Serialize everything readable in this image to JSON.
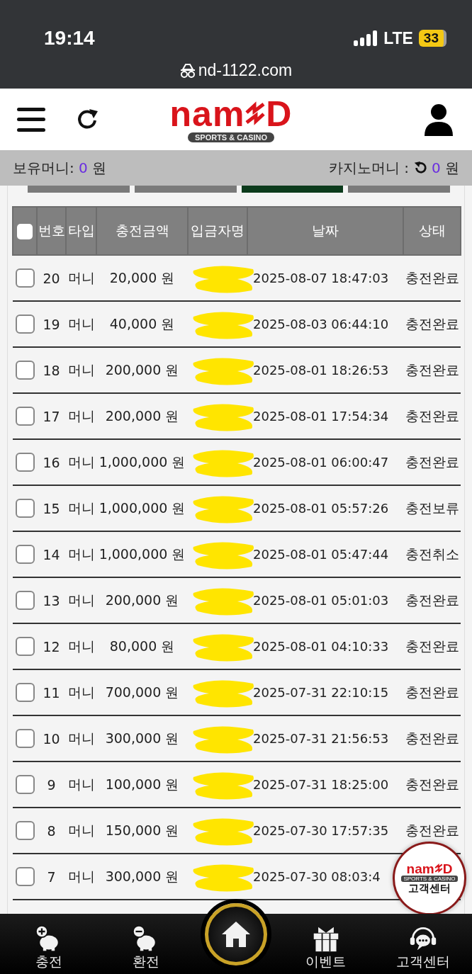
{
  "status_bar": {
    "time": "19:14",
    "network": "LTE",
    "battery": "33"
  },
  "browser": {
    "url": "nd-1122.com"
  },
  "header": {
    "logo_left": "nam",
    "logo_right": "D",
    "logo_tagline": "SPORTS & CASINO"
  },
  "balance": {
    "money_label": "보유머니:",
    "money_value": "0",
    "money_unit": "원",
    "casino_label": "카지노머니 :",
    "casino_value": "0",
    "casino_unit": "원"
  },
  "tabs": [
    {
      "selected": false
    },
    {
      "selected": false
    },
    {
      "selected": true
    },
    {
      "selected": false
    }
  ],
  "table": {
    "select_all_checked": false,
    "columns": [
      "번호",
      "타입",
      "충전금액",
      "입금자명",
      "날짜",
      "상태"
    ],
    "rows": [
      {
        "no": "20",
        "type": "머니",
        "amount": "20,000 원",
        "redacted": true,
        "date": "2025-08-07 18:47:03",
        "status": "충전완료",
        "checked": false
      },
      {
        "no": "19",
        "type": "머니",
        "amount": "40,000 원",
        "redacted": true,
        "date": "2025-08-03 06:44:10",
        "status": "충전완료",
        "checked": false
      },
      {
        "no": "18",
        "type": "머니",
        "amount": "200,000 원",
        "redacted": true,
        "date": "2025-08-01 18:26:53",
        "status": "충전완료",
        "checked": false
      },
      {
        "no": "17",
        "type": "머니",
        "amount": "200,000 원",
        "redacted": true,
        "date": "2025-08-01 17:54:34",
        "status": "충전완료",
        "checked": false
      },
      {
        "no": "16",
        "type": "머니",
        "amount": "1,000,000 원",
        "redacted": true,
        "date": "2025-08-01 06:00:47",
        "status": "충전완료",
        "checked": false
      },
      {
        "no": "15",
        "type": "머니",
        "amount": "1,000,000 원",
        "redacted": true,
        "date": "2025-08-01 05:57:26",
        "status": "충전보류",
        "checked": false
      },
      {
        "no": "14",
        "type": "머니",
        "amount": "1,000,000 원",
        "redacted": true,
        "date": "2025-08-01 05:47:44",
        "status": "충전취소",
        "checked": false
      },
      {
        "no": "13",
        "type": "머니",
        "amount": "200,000 원",
        "redacted": true,
        "date": "2025-08-01 05:01:03",
        "status": "충전완료",
        "checked": false
      },
      {
        "no": "12",
        "type": "머니",
        "amount": "80,000 원",
        "redacted": true,
        "date": "2025-08-01 04:10:33",
        "status": "충전완료",
        "checked": false
      },
      {
        "no": "11",
        "type": "머니",
        "amount": "700,000 원",
        "redacted": true,
        "date": "2025-07-31 22:10:15",
        "status": "충전완료",
        "checked": false
      },
      {
        "no": "10",
        "type": "머니",
        "amount": "300,000 원",
        "redacted": true,
        "date": "2025-07-31 21:56:53",
        "status": "충전완료",
        "checked": false
      },
      {
        "no": "9",
        "type": "머니",
        "amount": "100,000 원",
        "redacted": true,
        "date": "2025-07-31 18:25:00",
        "status": "충전완료",
        "checked": false
      },
      {
        "no": "8",
        "type": "머니",
        "amount": "150,000 원",
        "redacted": true,
        "date": "2025-07-30 17:57:35",
        "status": "충전완료",
        "checked": false
      },
      {
        "no": "7",
        "type": "머니",
        "amount": "300,000 원",
        "redacted": true,
        "date": "2025-07-30 08:03:4",
        "checked": false
      }
    ]
  },
  "support_badge": {
    "logo_left": "nam",
    "logo_right": "D",
    "tagline": "SPORTS & CASINO",
    "label": "고객센터"
  },
  "bottom_nav": [
    {
      "kind": "deposit",
      "label": "충전"
    },
    {
      "kind": "withdraw",
      "label": "환전"
    },
    {
      "kind": "home"
    },
    {
      "kind": "event",
      "label": "이벤트"
    },
    {
      "kind": "support",
      "label": "고객센터"
    }
  ]
}
